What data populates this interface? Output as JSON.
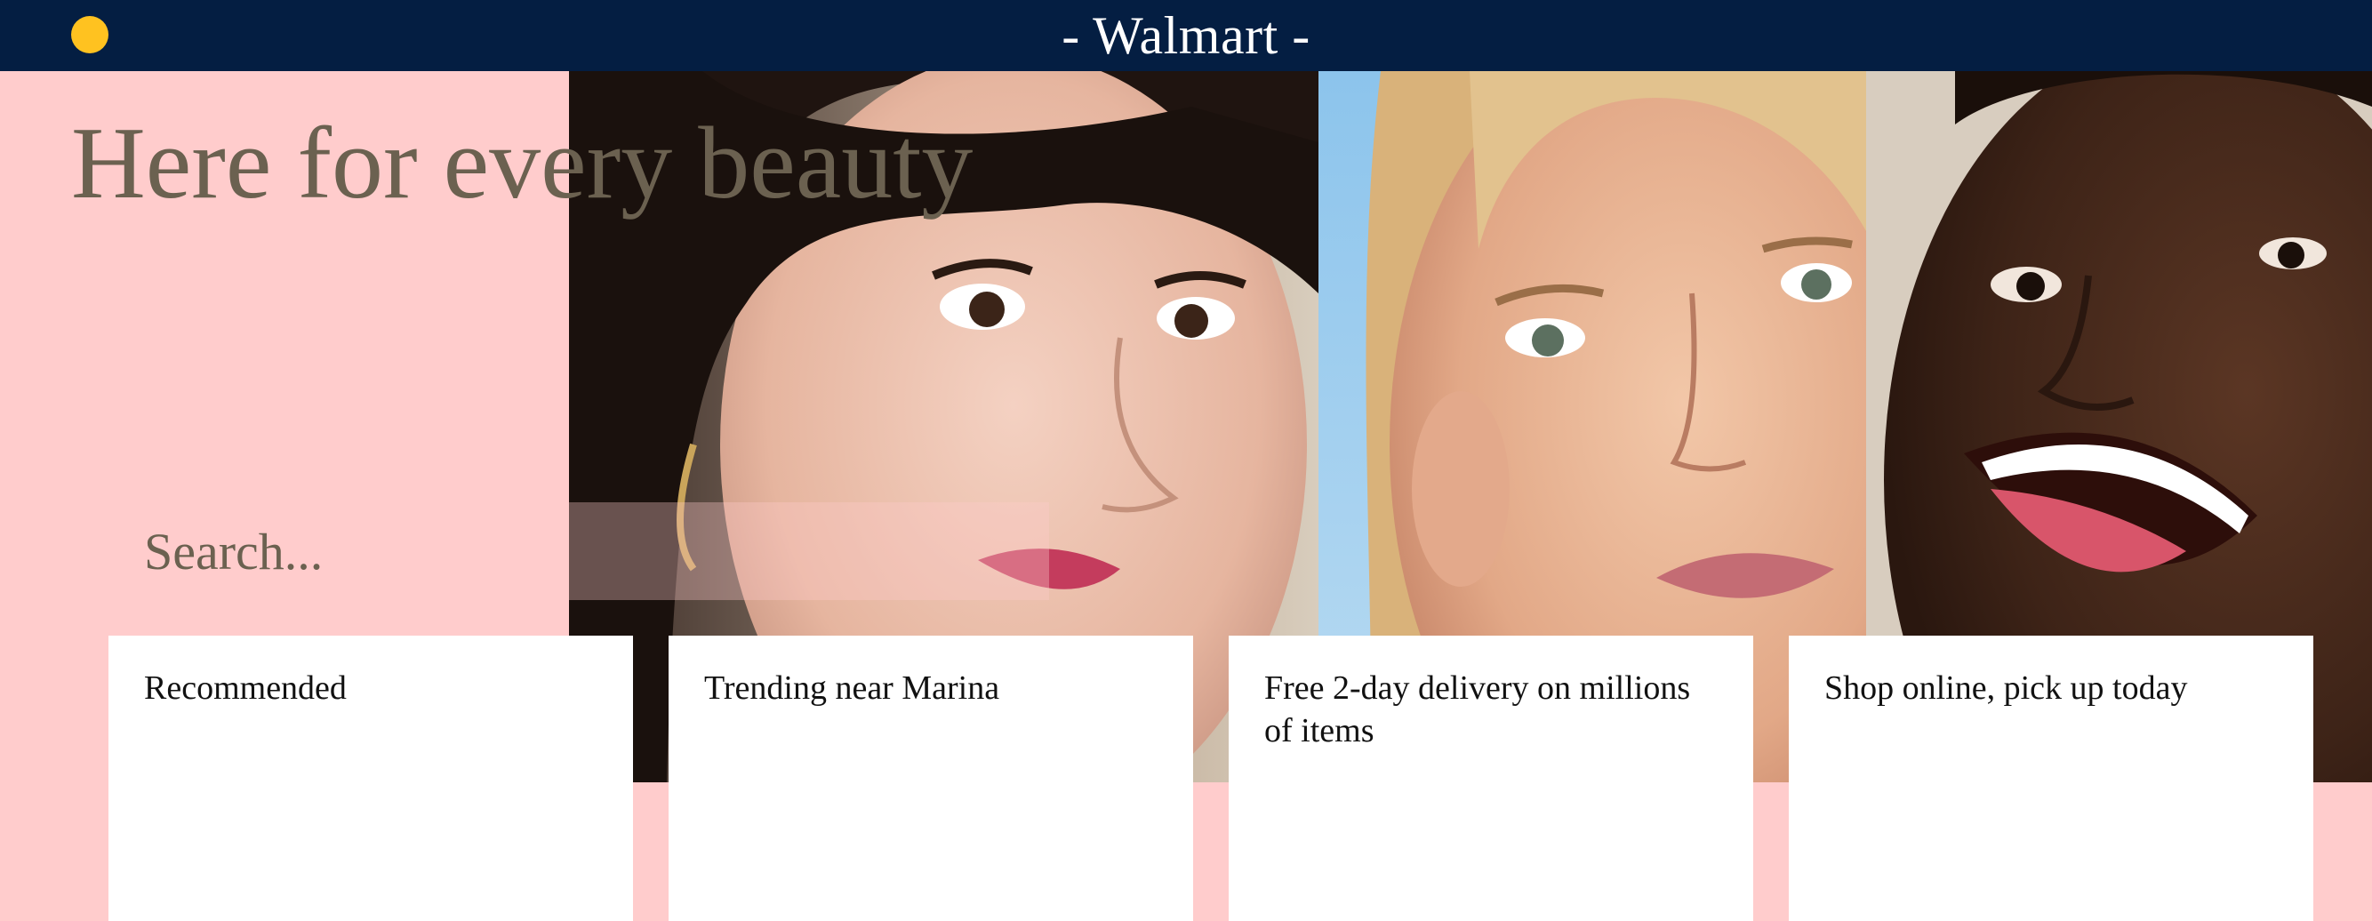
{
  "header": {
    "title": "- Walmart -",
    "menu_icon": "yellow-dot-icon",
    "colors": {
      "bar": "#041e42",
      "dot": "#ffc220"
    }
  },
  "hero": {
    "headline": "Here for every beauty",
    "images": [
      "portrait-woman-dark-hair",
      "portrait-woman-blonde-hair",
      "portrait-woman-smiling"
    ]
  },
  "search": {
    "placeholder": "Search..."
  },
  "cards": [
    {
      "label": "Recommended"
    },
    {
      "label": "Trending near Marina"
    },
    {
      "label": "Free 2-day delivery on millions of items"
    },
    {
      "label": "Shop online, pick up today"
    }
  ],
  "theme": {
    "background": "#ffcccc",
    "text": "#6b6150"
  }
}
